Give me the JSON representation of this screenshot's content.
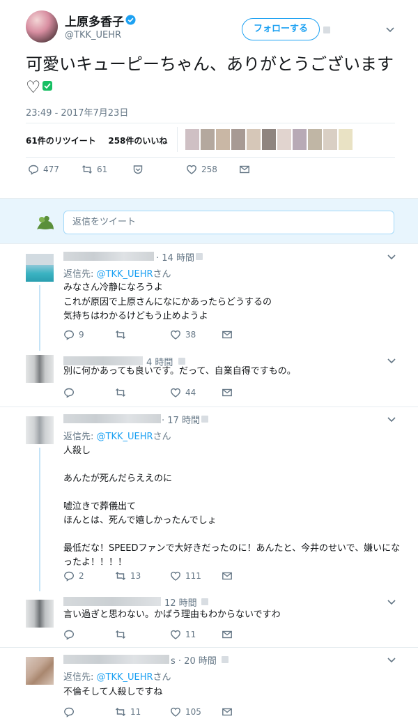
{
  "main_tweet": {
    "display_name": "上原多香子",
    "screen_name": "@TKK_UEHR",
    "follow_label": "フォローする",
    "text": "可愛いキューピーちゃん、ありがとうございます♡",
    "timestamp": "23:49 - 2017年7月23日",
    "retweets_label": "61件のリツイート",
    "likes_label": "258件のいいね",
    "reply_count": "477",
    "retweet_count": "61",
    "like_count": "258"
  },
  "reply_box": {
    "placeholder": "返信をツイート"
  },
  "replies": [
    {
      "time": "· 14 時間",
      "reply_to_prefix": "返信先: ",
      "reply_to_handle": "@TKK_UEHR",
      "reply_to_suffix": "さん",
      "text": "みなさん冷静になろうよ\nこれが原因で上原さんになにかあったらどうするの\n気持ちはわかるけどもう止めようよ",
      "replies": "9",
      "retweets": "",
      "likes": "38"
    },
    {
      "time": "4 時間",
      "text": "別に何かあっても良いです。だって、自業自得ですもの。",
      "replies": "",
      "retweets": "",
      "likes": "44"
    },
    {
      "time": "· 17 時間",
      "reply_to_prefix": "返信先: ",
      "reply_to_handle": "@TKK_UEHR",
      "reply_to_suffix": "さん",
      "text": "人殺し\n\nあんたが死んだらええのに\n\n嘘泣きで葬儀出て\nほんとは、死んで嬉しかったんでしょ\n\n最低だな！SPEEDファンで大好きだったのに！あんたと、今井のせいで、嫌いになったよ！！！！",
      "replies": "2",
      "retweets": "13",
      "likes": "111"
    },
    {
      "time": "12 時間",
      "text": "言い過ぎと思わない。かばう理由もわからないですわ",
      "replies": "",
      "retweets": "",
      "likes": "11"
    },
    {
      "time": "s · 20 時間",
      "reply_to_prefix": "返信先: ",
      "reply_to_handle": "@TKK_UEHR",
      "reply_to_suffix": "さん",
      "text": "不倫そして人殺しですね",
      "replies": "",
      "retweets": "11",
      "likes": "105"
    }
  ],
  "colors": {
    "accent": "#1da1f2",
    "muted": "#657786",
    "verified_green": "#17bf63",
    "reply_bg": "#e8f5fd"
  }
}
